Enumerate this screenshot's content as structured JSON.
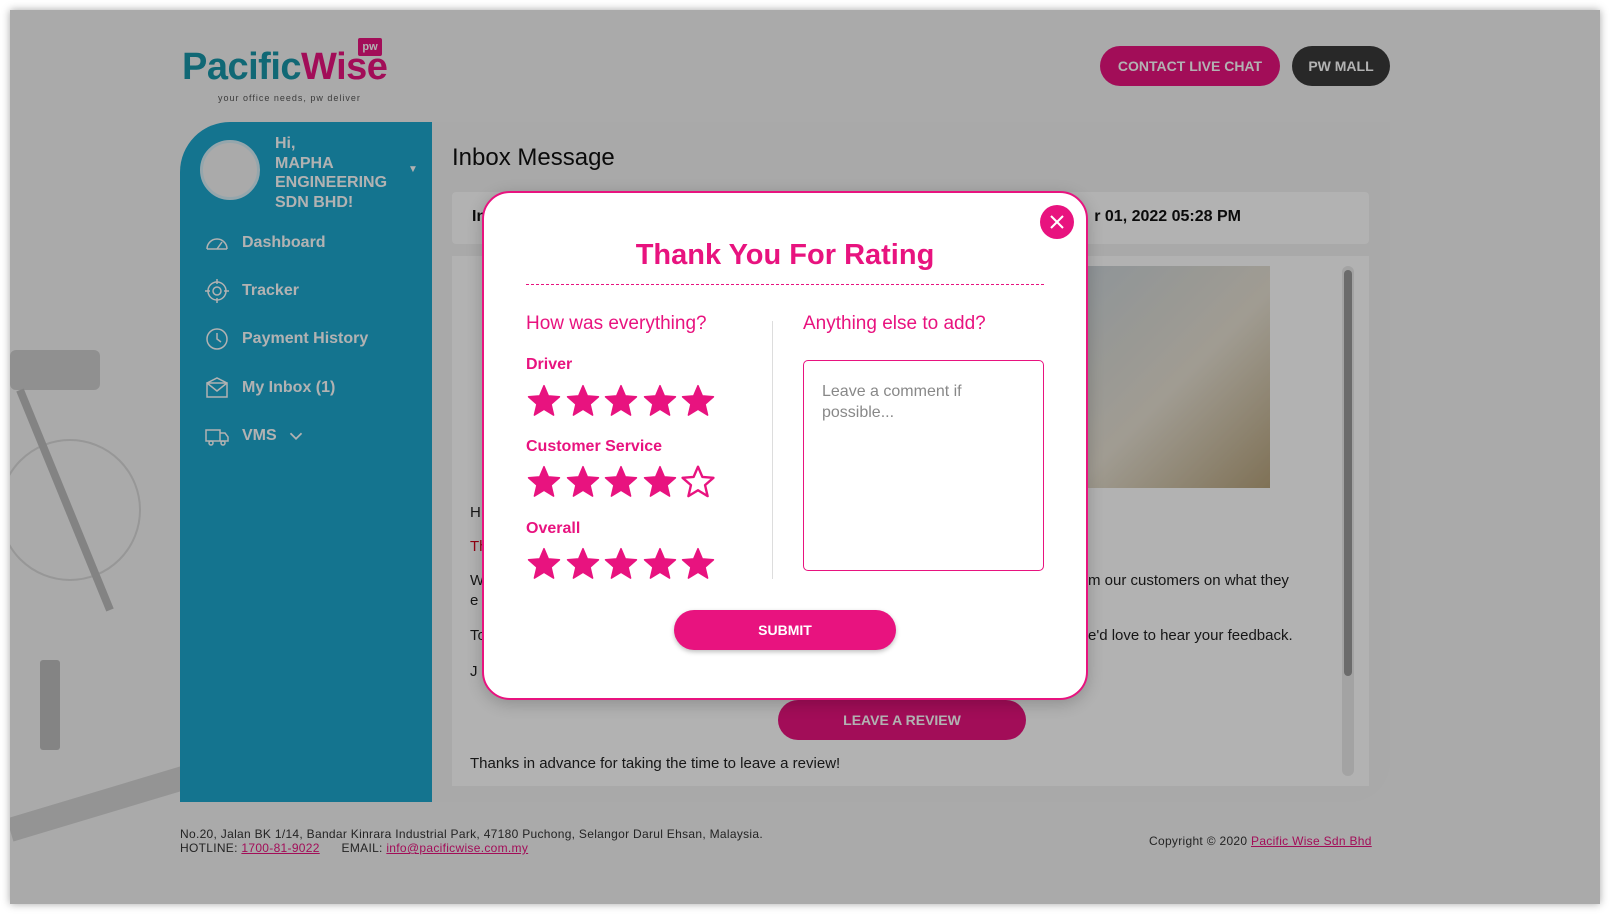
{
  "brand": {
    "logo_text_part1": "Pacific",
    "logo_text_part2": "Wise",
    "logo_badge": "pw",
    "tagline": "your office needs, pw deliver",
    "accent": "#e8137f",
    "teal": "#1ea6cd"
  },
  "header": {
    "chat_label": "CONTACT LIVE CHAT",
    "mall_label": "PW MALL"
  },
  "sidebar": {
    "greeting": [
      "Hi,",
      "MAPHA",
      "ENGINEERING",
      "SDN BHD!"
    ],
    "items": [
      {
        "label": "Dashboard",
        "icon": "gauge-icon"
      },
      {
        "label": "Tracker",
        "icon": "crosshair-icon"
      },
      {
        "label": "Payment History",
        "icon": "clock-icon"
      },
      {
        "label": "My Inbox (1)",
        "icon": "envelope-icon"
      },
      {
        "label": "VMS",
        "icon": "truck-icon"
      }
    ]
  },
  "inbox": {
    "title": "Inbox Message",
    "subject_partial": "In",
    "date_partial": "r 01, 2022 05:28 PM",
    "line_h": "H",
    "line_th": "Th",
    "line_w1": "W",
    "line_w1_right": "m our customers on what they",
    "line_w2": "e",
    "line_to": "To",
    "line_to_right": "e'd love to hear your feedback.",
    "line_j": "J",
    "review_button": "LEAVE A REVIEW",
    "closing": "Thanks in advance for taking the time to leave a review!"
  },
  "modal": {
    "title": "Thank You For Rating",
    "left_heading": "How was everything?",
    "right_heading": "Anything else to add?",
    "categories": [
      {
        "label": "Driver",
        "rating": 5,
        "max": 5
      },
      {
        "label": "Customer Service",
        "rating": 4,
        "max": 5
      },
      {
        "label": "Overall",
        "rating": 5,
        "max": 5
      }
    ],
    "comment_placeholder": "Leave a comment if possible...",
    "submit_label": "SUBMIT"
  },
  "footer": {
    "address": "No.20, Jalan BK 1/14, Bandar Kinrara Industrial Park, 47180 Puchong, Selangor Darul Ehsan, Malaysia.",
    "hotline_label": "HOTLINE:",
    "hotline": "1700-81-9022",
    "email_label": "EMAIL:",
    "email": "info@pacificwise.com.my",
    "copyright_text": "Copyright © 2020",
    "copyright_link": "Pacific Wise Sdn Bhd"
  }
}
